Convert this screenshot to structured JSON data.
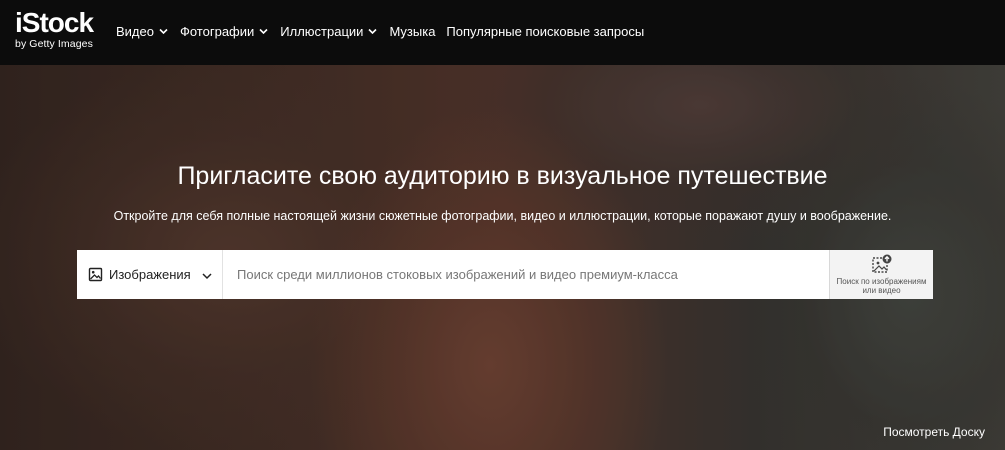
{
  "header": {
    "logo": {
      "main": "iStock",
      "sub": "by Getty Images"
    },
    "nav": [
      {
        "label": "Видео",
        "has_dropdown": true
      },
      {
        "label": "Фотографии",
        "has_dropdown": true
      },
      {
        "label": "Иллюстрации",
        "has_dropdown": true
      },
      {
        "label": "Музыка",
        "has_dropdown": false
      },
      {
        "label": "Популярные поисковые запросы",
        "has_dropdown": false
      }
    ]
  },
  "hero": {
    "title": "Пригласите свою аудиторию в визуальное путешествие",
    "subtitle": "Откройте для себя полные настоящей жизни сюжетные фотографии, видео и иллюстрации, которые поражают душу и воображение.",
    "search": {
      "type_label": "Изображения",
      "placeholder": "Поиск среди миллионов стоковых изображений и видео премиум-класса",
      "value": "",
      "visual_search_label": "Поиск по изображениям или видео"
    },
    "board_link": "Посмотреть Доску"
  },
  "colors": {
    "header_bg": "#0c0c0c",
    "text_light": "#ffffff"
  }
}
